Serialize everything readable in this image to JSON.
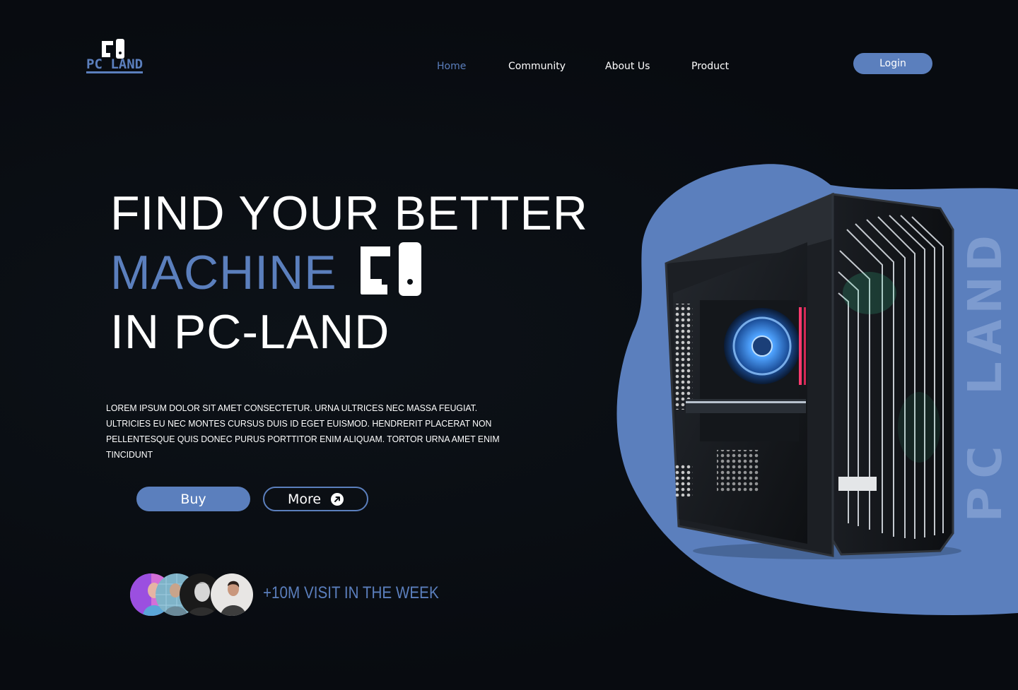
{
  "brand": {
    "logo_text": "PC LAND"
  },
  "nav": {
    "items": [
      {
        "label": "Home",
        "active": true
      },
      {
        "label": "Community",
        "active": false
      },
      {
        "label": "About Us",
        "active": false
      },
      {
        "label": "Product",
        "active": false
      }
    ],
    "login_label": "Login"
  },
  "hero": {
    "line1": "FIND YOUR BETTER",
    "line2": "MACHINE",
    "line3": "IN PC-LAND",
    "description": "LOREM IPSUM DOLOR SIT AMET CONSECTETUR. URNA ULTRICES NEC MASSA FEUGIAT. ULTRICIES EU NEC MONTES CURSUS DUIS ID EGET EUISMOD. HENDRERIT PLACERAT NON PELLENTESQUE QUIS DONEC PURUS PORTTITOR ENIM ALIQUAM. TORTOR URNA AMET ENIM TINCIDUNT",
    "buy_label": "Buy",
    "more_label": "More"
  },
  "social_proof": {
    "visits_text": "+10M VISIT IN THE WEEK"
  },
  "side": {
    "vertical_text": "PC LAND"
  },
  "colors": {
    "accent": "#5b7fbd",
    "background": "#0a0e13",
    "text": "#ffffff"
  },
  "icons": [
    "pc-logo-icon",
    "arrow-up-right-icon",
    "pc-hero-icon"
  ]
}
